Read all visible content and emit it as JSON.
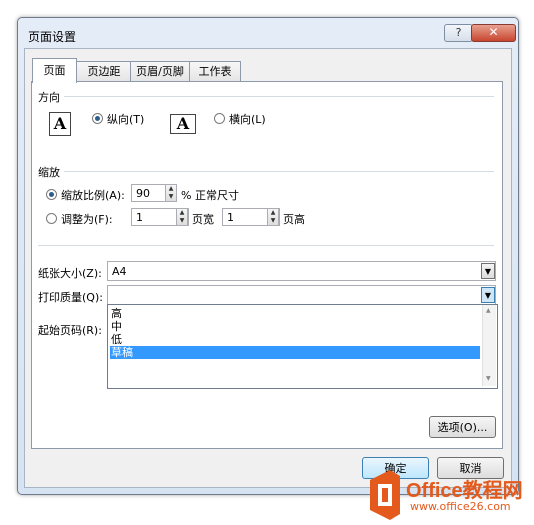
{
  "window": {
    "title": "页面设置",
    "help_label": "?",
    "close_label": "✕"
  },
  "tabs": [
    {
      "label": "页面"
    },
    {
      "label": "页边距"
    },
    {
      "label": "页眉/页脚"
    },
    {
      "label": "工作表"
    }
  ],
  "orientation": {
    "heading": "方向",
    "icon_letter": "A",
    "portrait_label": "纵向(T)",
    "landscape_label": "横向(L)",
    "selected": "portrait"
  },
  "scaling": {
    "heading": "缩放",
    "adjust_label": "缩放比例(A):",
    "adjust_value": "90",
    "adjust_suffix": "% 正常尺寸",
    "fit_label": "调整为(F):",
    "fit_wide_value": "1",
    "fit_wide_suffix": "页宽",
    "fit_tall_value": "1",
    "fit_tall_suffix": "页高",
    "selected": "adjust"
  },
  "paper_size": {
    "label": "纸张大小(Z):",
    "value": "A4"
  },
  "print_quality": {
    "label": "打印质量(Q):",
    "value": "",
    "options": [
      "高",
      "中",
      "低",
      "草稿"
    ],
    "highlighted": "草稿"
  },
  "first_page": {
    "label": "起始页码(R):"
  },
  "buttons": {
    "options": "选项(O)...",
    "ok": "确定",
    "cancel": "取消"
  },
  "watermark": {
    "brand": "Office教程网",
    "url": "www.office26.com"
  }
}
